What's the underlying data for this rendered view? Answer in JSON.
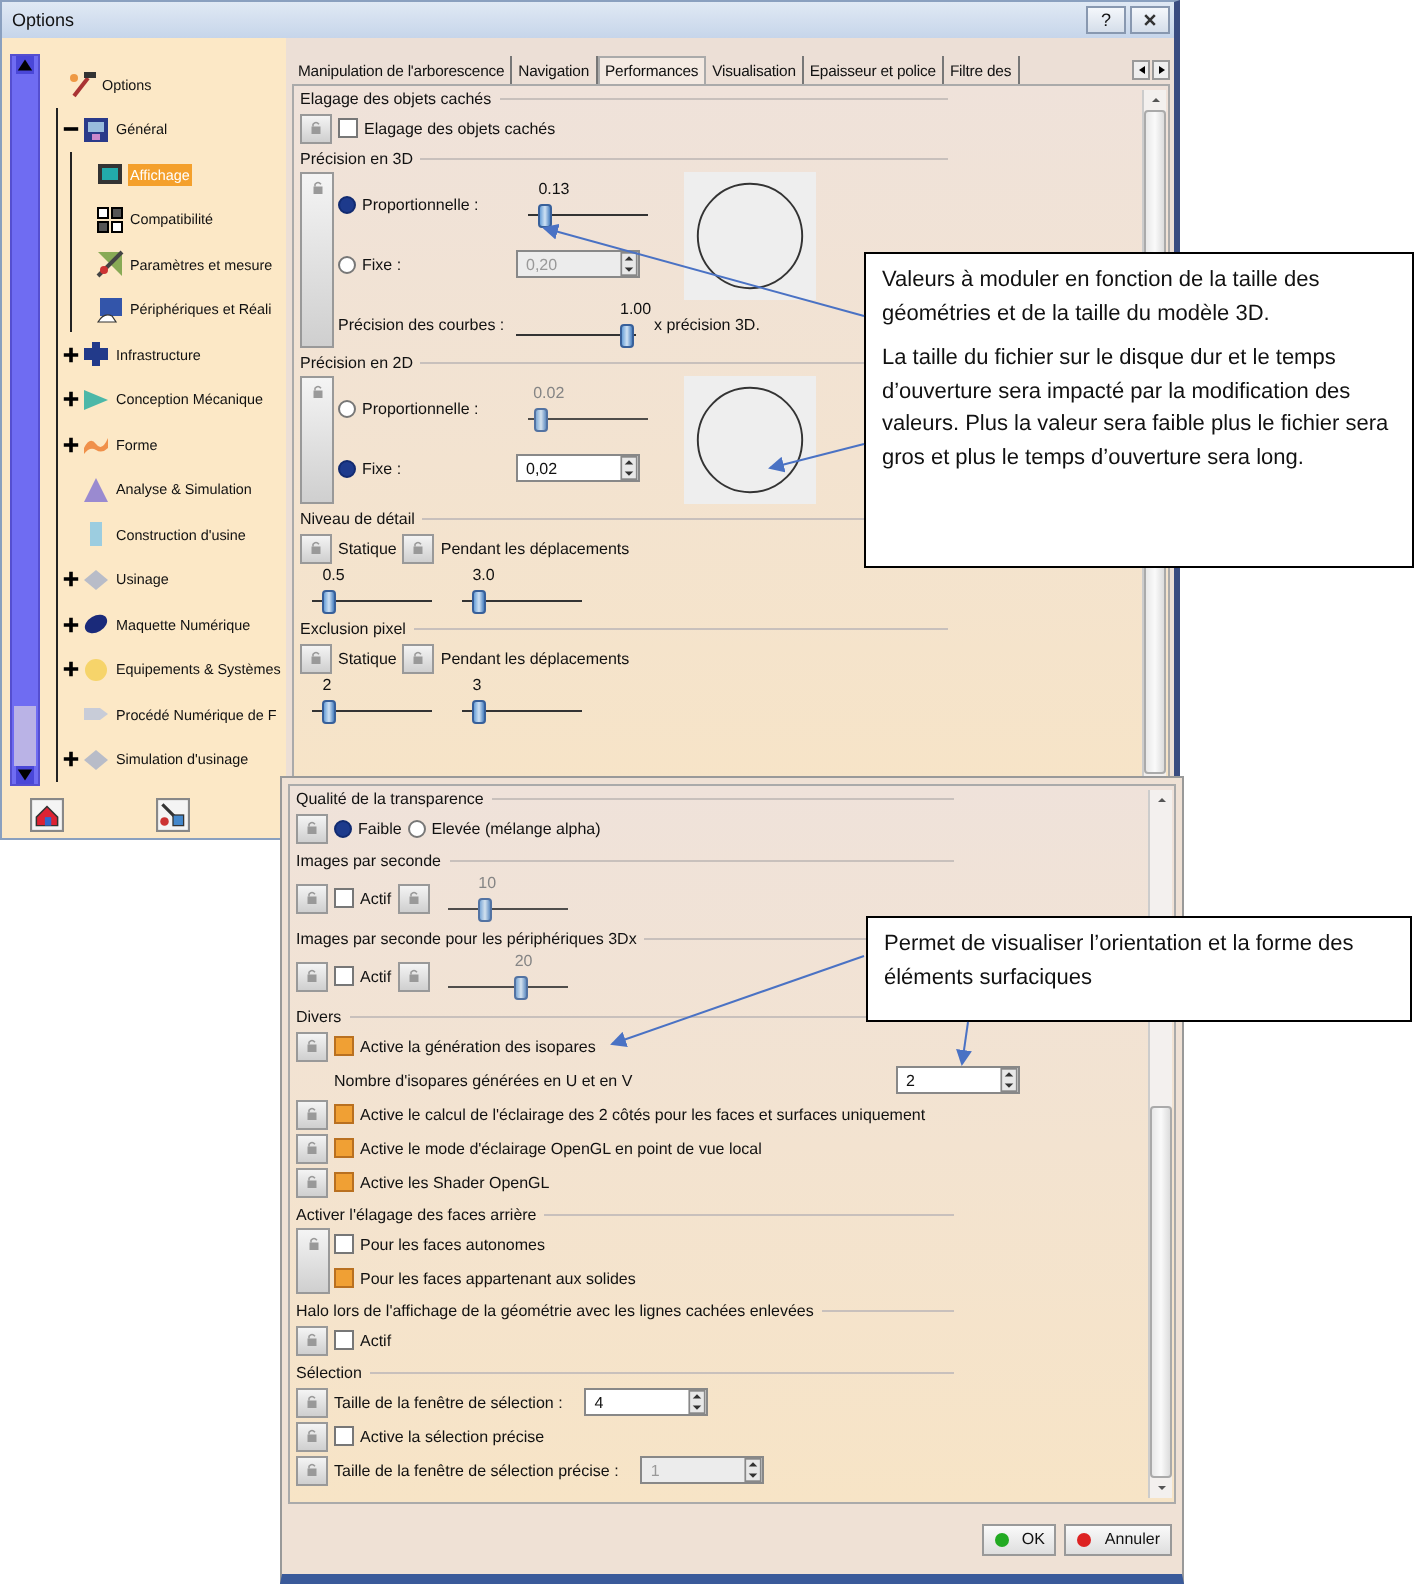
{
  "window": {
    "title": "Options",
    "help": "?"
  },
  "tree": [
    {
      "label": "Options",
      "kind": "root",
      "selected": false,
      "children": [
        {
          "label": "Général",
          "kind": "monitor",
          "expanded": true,
          "selected": false,
          "children": [
            {
              "label": "Affichage",
              "kind": "screen",
              "selected": true
            },
            {
              "label": "Compatibilité",
              "kind": "squares",
              "selected": false
            },
            {
              "label": "Paramètres et mesure",
              "kind": "ruler",
              "selected": false
            },
            {
              "label": "Périphériques et Réali",
              "kind": "hand",
              "selected": false
            }
          ]
        },
        {
          "label": "Infrastructure",
          "kind": "block",
          "expanded": false,
          "selected": false
        },
        {
          "label": "Conception Mécanique",
          "kind": "wedge",
          "expanded": false,
          "selected": false
        },
        {
          "label": "Forme",
          "kind": "wave",
          "expanded": false,
          "selected": false
        },
        {
          "label": "Analyse & Simulation",
          "kind": "pyramid",
          "selected": false
        },
        {
          "label": "Construction d'usine",
          "kind": "column",
          "selected": false
        },
        {
          "label": "Usinage",
          "kind": "diamond",
          "expanded": false,
          "selected": false
        },
        {
          "label": "Maquette Numérique",
          "kind": "ellipse",
          "expanded": false,
          "selected": false
        },
        {
          "label": "Equipements & Systèmes",
          "kind": "disc",
          "expanded": false,
          "selected": false
        },
        {
          "label": "Procédé Numérique de F",
          "kind": "arrow",
          "selected": false
        },
        {
          "label": "Simulation d'usinage",
          "kind": "diamond",
          "expanded": false,
          "selected": false
        }
      ]
    }
  ],
  "tabs": [
    {
      "label": "Manipulation de l'arborescence",
      "selected": false
    },
    {
      "label": "Navigation",
      "selected": false
    },
    {
      "label": "Performances",
      "selected": true
    },
    {
      "label": "Visualisation",
      "selected": false
    },
    {
      "label": "Epaisseur et police",
      "selected": false
    },
    {
      "label": "Filtre des",
      "selected": false
    }
  ],
  "upper_sections": [
    {
      "title": "Elagage des objets cachés",
      "side_lock": false,
      "preview": false,
      "rows": [
        {
          "controls": [
            {
              "kind": "lock"
            },
            {
              "kind": "checkbox",
              "label": "Elagage des objets cachés",
              "checked": false
            }
          ]
        }
      ]
    },
    {
      "title": "Précision en 3D",
      "side_lock": true,
      "preview": true,
      "rows": [
        {
          "controls": [
            {
              "kind": "radio",
              "label": "Proportionnelle :",
              "selected": true
            },
            {
              "kind": "slider",
              "reading": "0.13",
              "level": 0.1,
              "disabled": false
            }
          ]
        },
        {
          "controls": [
            {
              "kind": "radio",
              "label": "Fixe :",
              "selected": false
            },
            {
              "kind": "spin",
              "value": "0,20",
              "disabled": true
            }
          ]
        },
        {
          "controls": [
            {
              "kind": "label",
              "text": "Précision des courbes :"
            },
            {
              "kind": "slider",
              "reading": "1.00",
              "level": 1,
              "disabled": false
            },
            {
              "kind": "text",
              "text": "x précision 3D."
            }
          ]
        }
      ]
    },
    {
      "title": "Précision en 2D",
      "side_lock": true,
      "preview": true,
      "rows": [
        {
          "controls": [
            {
              "kind": "radio",
              "label": "Proportionnelle :",
              "selected": false
            },
            {
              "kind": "slider",
              "reading": "0.02",
              "level": 0.05,
              "disabled": true
            }
          ]
        },
        {
          "controls": [
            {
              "kind": "radio",
              "label": "Fixe :",
              "selected": true
            },
            {
              "kind": "spin",
              "value": "0,02",
              "disabled": false
            }
          ]
        }
      ]
    },
    {
      "title": "Niveau de détail",
      "side_lock": false,
      "preview": false,
      "rows": [
        {
          "controls": [
            {
              "kind": "lock"
            },
            {
              "kind": "text",
              "text": "Statique"
            },
            {
              "kind": "lock"
            },
            {
              "kind": "text",
              "text": "Pendant les déplacements"
            }
          ]
        },
        {
          "controls": [
            {
              "kind": "slider",
              "reading": "0.5",
              "level": 0.1,
              "disabled": false
            },
            {
              "kind": "slider",
              "reading": "3.0",
              "level": 0.1,
              "disabled": false
            }
          ]
        }
      ]
    },
    {
      "title": "Exclusion pixel",
      "side_lock": false,
      "preview": false,
      "rows": [
        {
          "controls": [
            {
              "kind": "lock"
            },
            {
              "kind": "text",
              "text": "Statique"
            },
            {
              "kind": "lock"
            },
            {
              "kind": "text",
              "text": "Pendant les déplacements"
            }
          ]
        },
        {
          "controls": [
            {
              "kind": "slider",
              "reading": "2",
              "level": 0.1,
              "disabled": false
            },
            {
              "kind": "slider",
              "reading": "3",
              "level": 0.1,
              "disabled": false
            }
          ]
        }
      ]
    }
  ],
  "lower_sections": [
    {
      "title": "Qualité de la transparence",
      "side_lock": false,
      "preview": false,
      "rows": [
        {
          "controls": [
            {
              "kind": "lock"
            },
            {
              "kind": "radio",
              "label": "Faible",
              "selected": true
            },
            {
              "kind": "radio",
              "label": "Elevée (mélange alpha)",
              "selected": false
            }
          ]
        }
      ]
    },
    {
      "title": "Images par seconde",
      "side_lock": false,
      "preview": false,
      "rows": [
        {
          "controls": [
            {
              "kind": "lock"
            },
            {
              "kind": "checkbox",
              "label": "Actif",
              "checked": false
            },
            {
              "kind": "lock"
            },
            {
              "kind": "slider",
              "reading": "10",
              "level": 0.3,
              "disabled": true
            }
          ]
        }
      ]
    },
    {
      "title": "Images par seconde pour les périphériques 3Dx",
      "side_lock": false,
      "preview": false,
      "rows": [
        {
          "controls": [
            {
              "kind": "lock"
            },
            {
              "kind": "checkbox",
              "label": "Actif",
              "checked": false
            },
            {
              "kind": "lock"
            },
            {
              "kind": "slider",
              "reading": "20",
              "level": 0.65,
              "disabled": true
            }
          ]
        }
      ]
    },
    {
      "title": "Divers",
      "side_lock": false,
      "preview": false,
      "rows": [
        {
          "controls": [
            {
              "kind": "lock"
            },
            {
              "kind": "checkbox",
              "label": "Active la génération des isopares",
              "checked": true
            }
          ]
        },
        {
          "indent": true,
          "controls": [
            {
              "kind": "label",
              "text": "Nombre d'isopares générées en U et en V"
            },
            {
              "kind": "spin",
              "value": "2",
              "disabled": false
            }
          ]
        },
        {
          "controls": [
            {
              "kind": "lock"
            },
            {
              "kind": "checkbox",
              "label": "Active le calcul de l'éclairage des 2 côtés pour les faces et surfaces uniquement",
              "checked": true
            }
          ]
        },
        {
          "controls": [
            {
              "kind": "lock"
            },
            {
              "kind": "checkbox",
              "label": "Active le mode d'éclairage OpenGL en point de vue local",
              "checked": true
            }
          ]
        },
        {
          "controls": [
            {
              "kind": "lock"
            },
            {
              "kind": "checkbox",
              "label": "Active les Shader OpenGL",
              "checked": true
            }
          ]
        }
      ]
    },
    {
      "title": "Activer l'élagage des faces arrière",
      "side_lock": true,
      "preview": false,
      "rows": [
        {
          "controls": [
            {
              "kind": "checkbox",
              "label": "Pour les faces autonomes",
              "checked": false
            }
          ]
        },
        {
          "controls": [
            {
              "kind": "checkbox",
              "label": "Pour les faces appartenant aux solides",
              "checked": true
            }
          ]
        }
      ]
    },
    {
      "title": "Halo lors de l'affichage de la géométrie avec les lignes cachées enlevées",
      "side_lock": false,
      "preview": false,
      "rows": [
        {
          "controls": [
            {
              "kind": "lock"
            },
            {
              "kind": "checkbox",
              "label": "Actif",
              "checked": false
            }
          ]
        }
      ]
    },
    {
      "title": "Sélection",
      "side_lock": false,
      "preview": false,
      "rows": [
        {
          "controls": [
            {
              "kind": "lock"
            },
            {
              "kind": "label",
              "text": "Taille de la fenêtre de sélection :"
            },
            {
              "kind": "spin",
              "value": "4",
              "disabled": false
            }
          ]
        },
        {
          "controls": [
            {
              "kind": "lock"
            },
            {
              "kind": "checkbox",
              "label": "Active la sélection précise",
              "checked": false
            }
          ]
        },
        {
          "controls": [
            {
              "kind": "lock"
            },
            {
              "kind": "label",
              "text": "Taille de la fenêtre de sélection précise :"
            },
            {
              "kind": "spin",
              "value": "1",
              "disabled": true
            }
          ]
        }
      ]
    }
  ],
  "buttons": [
    {
      "label": "OK",
      "kind": "ok"
    },
    {
      "label": "Annuler",
      "kind": "cancel"
    }
  ],
  "callouts": [
    {
      "paragraphs": [
        "Valeurs à moduler en fonction de la taille des géométries et de la taille du modèle 3D.",
        "La taille du fichier sur le disque dur et le temps d’ouverture sera  impacté par la modification des valeurs. Plus la valeur sera faible plus le fichier sera gros et plus le temps d’ouverture sera long."
      ]
    },
    {
      "paragraphs": [
        "Permet de visualiser l’orientation et la forme des éléments surfaciques"
      ]
    }
  ]
}
